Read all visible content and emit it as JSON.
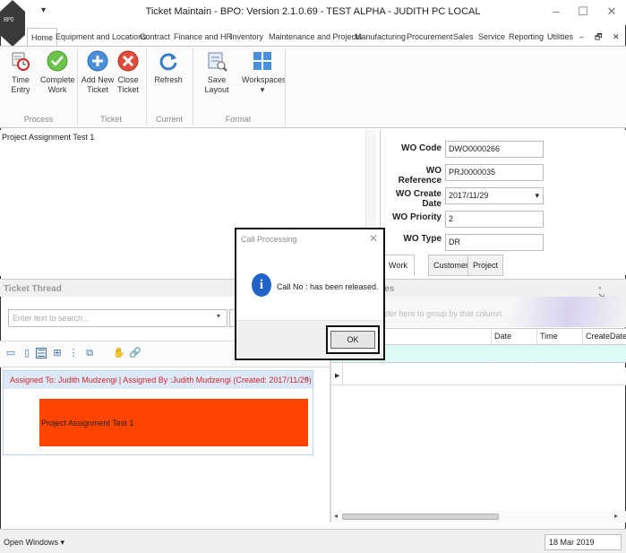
{
  "window": {
    "title": "Ticket Maintain - BPO: Version 2.1.0.69 - TEST ALPHA - JUDITH PC LOCAL",
    "qat_glyph": "▾",
    "minimize": "–",
    "maximize": "☐",
    "close": "✕"
  },
  "menu": {
    "tabs": [
      "Home",
      "Equipment and Locations",
      "Contract",
      "Finance and HR",
      "Inventory",
      "Maintenance and Projects",
      "Manufacturing",
      "Procurement",
      "Sales",
      "Service",
      "Reporting",
      "Utilities"
    ],
    "right_controls": [
      "–",
      "🗗",
      "✕"
    ]
  },
  "ribbon": {
    "groups": [
      {
        "label": "Process",
        "buttons": [
          {
            "label": "Time Entry",
            "icon": "time-entry-icon"
          },
          {
            "label": "Complete Work",
            "icon": "checkmark-icon"
          }
        ]
      },
      {
        "label": "Ticket",
        "buttons": [
          {
            "label": "Add New Ticket",
            "icon": "add-icon"
          },
          {
            "label": "Close Ticket",
            "icon": "close-ticket-icon"
          }
        ]
      },
      {
        "label": "Current",
        "buttons": [
          {
            "label": "Refresh",
            "icon": "refresh-icon"
          }
        ]
      },
      {
        "label": "Format",
        "buttons": [
          {
            "label": "Save Layout",
            "icon": "save-layout-icon"
          },
          {
            "label": "Workspaces",
            "icon": "workspaces-icon"
          }
        ]
      }
    ],
    "workspaces_arrow": "▾"
  },
  "assignment": {
    "text": "Project Assignment Test 1"
  },
  "work_order": {
    "fields": [
      {
        "label": "WO Code",
        "value": "DWO0000266"
      },
      {
        "label": "WO Reference",
        "value": "PRJ0000035"
      },
      {
        "label": "WO Create Date",
        "value": "2017/11/29"
      },
      {
        "label": "WO Priority",
        "value": "2"
      },
      {
        "label": "WO Type",
        "value": "DR"
      }
    ],
    "tabs": [
      "Work Order",
      "Customer",
      "Project"
    ],
    "date_arrow": "▾"
  },
  "thread": {
    "title": "Ticket Thread",
    "search_placeholder": "Enter text to search...",
    "item_header": "Assigned To: Judith Mudzengi | Assigned By :Judith Mudzengi (Created: 2017/11/29)",
    "item_body": "Project Assignment Test 1",
    "collapse_glyph": "˄"
  },
  "notes": {
    "title": "tes",
    "group_hint": "ader here to group by that column",
    "columns": [
      "Date",
      "Time",
      "CreateDate"
    ],
    "controls": "▫ ⇲"
  },
  "status": {
    "open_windows": "Open Windows ▾",
    "date": "18 Mar 2019"
  },
  "dialog": {
    "title": "Call Processing",
    "close": "✕",
    "info_glyph": "i",
    "message": "Call No :  has been released.",
    "ok": "OK"
  }
}
